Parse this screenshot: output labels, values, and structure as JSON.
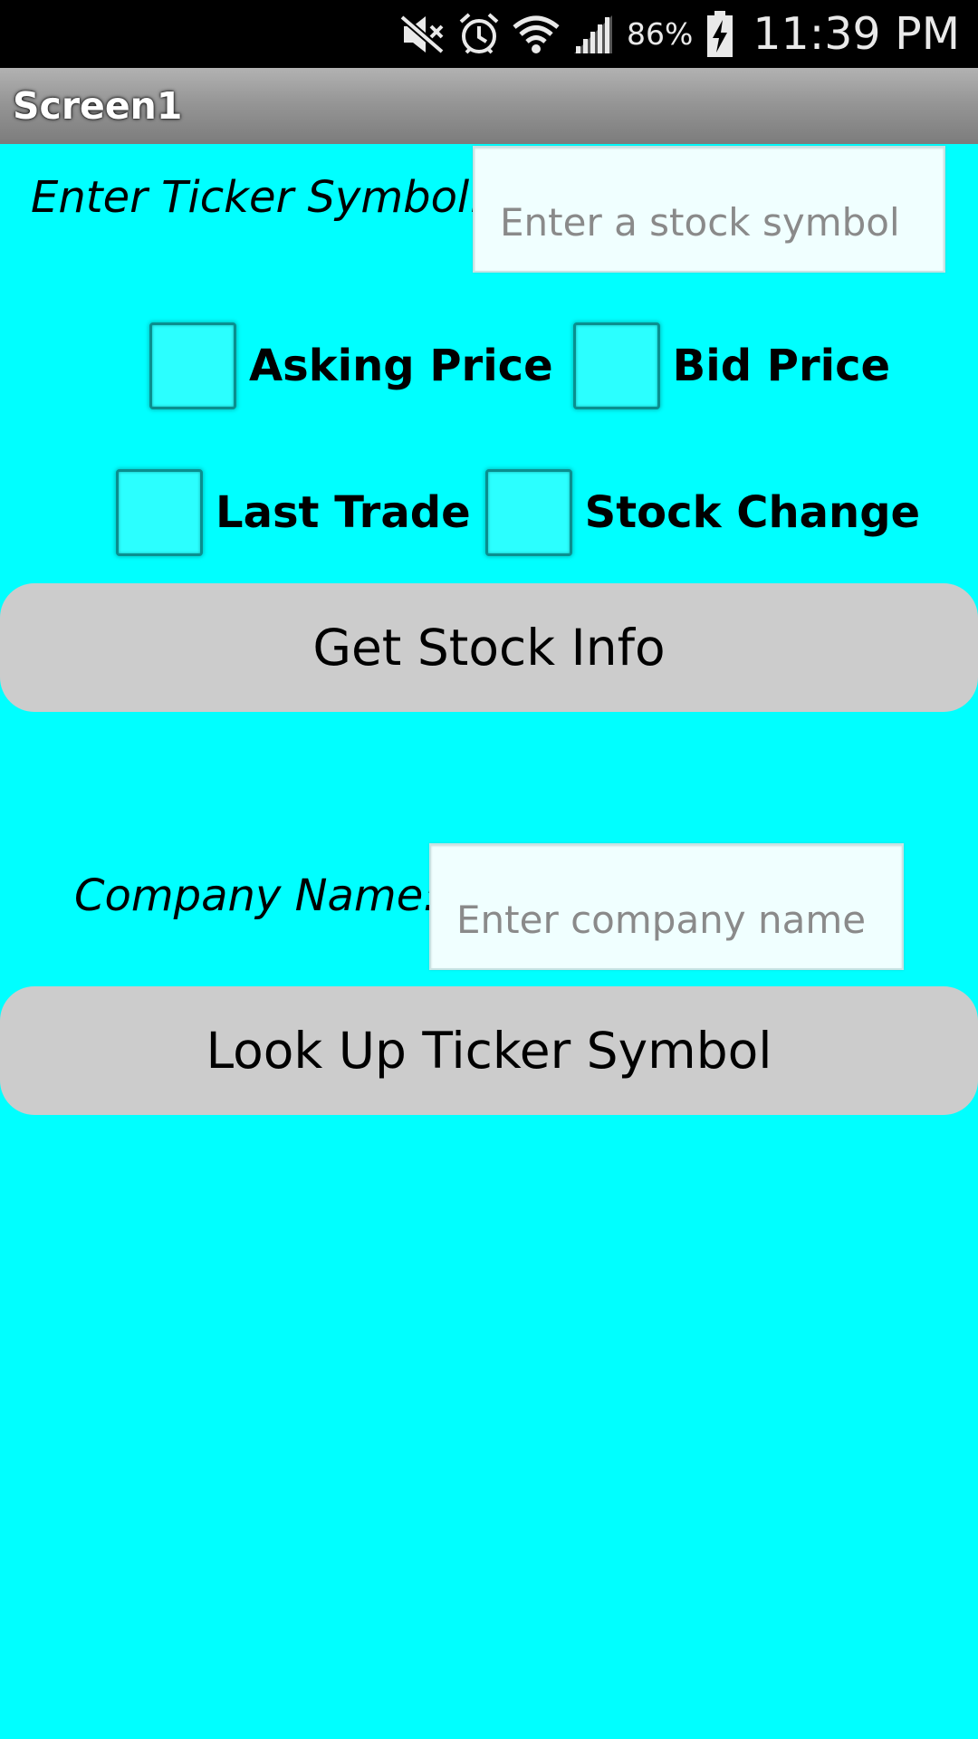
{
  "status_bar": {
    "icons": [
      "mute-icon",
      "alarm-icon",
      "wifi-icon",
      "signal-icon",
      "battery-charging-icon"
    ],
    "battery_percent": "86%",
    "time": "11:39 PM"
  },
  "title_bar": {
    "title": "Screen1"
  },
  "ticker": {
    "label": "Enter Ticker Symbol.",
    "placeholder": "Enter a stock symbol",
    "value": ""
  },
  "checkboxes": {
    "asking_price": {
      "label": "Asking Price",
      "checked": false
    },
    "bid_price": {
      "label": "Bid Price",
      "checked": false
    },
    "last_trade": {
      "label": "Last Trade",
      "checked": false
    },
    "stock_change": {
      "label": "Stock Change",
      "checked": false
    }
  },
  "get_stock_button": {
    "label": "Get Stock Info"
  },
  "company": {
    "label": "Company Name:",
    "placeholder": "Enter company name",
    "value": ""
  },
  "lookup_button": {
    "label": "Look Up Ticker Symbol"
  },
  "colors": {
    "background": "#00ffff",
    "button": "#cccccc",
    "input_background": "#f0ffff",
    "status_bar": "#000000"
  }
}
